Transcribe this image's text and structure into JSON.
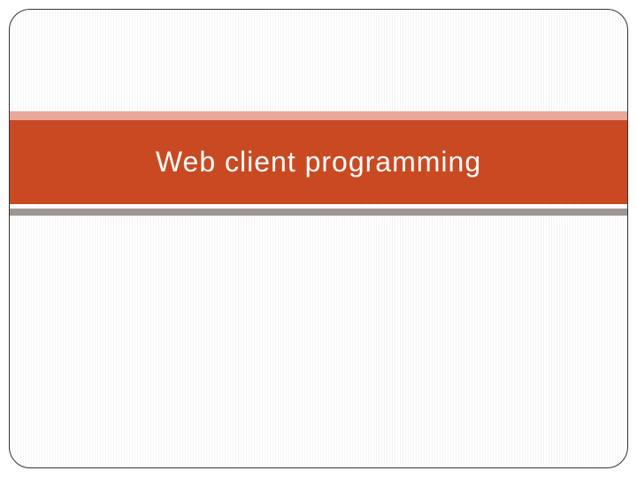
{
  "slide": {
    "title": "Web client programming"
  },
  "colors": {
    "titleBand": "#c94a22",
    "topAccent": "#e8a89a",
    "bottomAccent": "#9e9690"
  }
}
